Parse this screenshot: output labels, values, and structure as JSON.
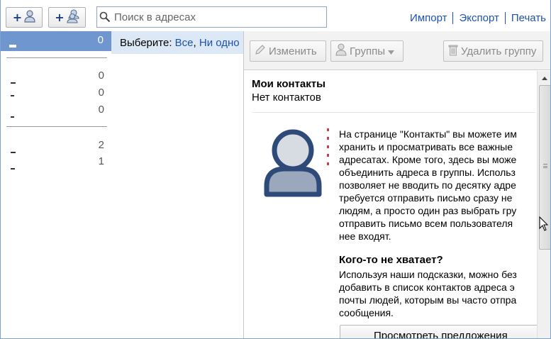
{
  "toolbar": {
    "add_contact_icon": "add-person-icon",
    "add_group_icon": "add-group-icon",
    "search_placeholder": "Поиск в адресах",
    "links": [
      "Импорт",
      "Экспорт",
      "Печать"
    ]
  },
  "sidebar": {
    "selected_count": "0",
    "items": [
      {
        "count": "0"
      },
      {
        "count": "0"
      },
      {
        "count": "0"
      },
      {
        "count": "2"
      },
      {
        "count": "1"
      }
    ]
  },
  "select_bar": {
    "label": "Выберите:",
    "all": "Все",
    "none": "Ни одно"
  },
  "panel_toolbar": {
    "edit": "Изменить",
    "groups": "Группы",
    "delete_group": "Удалить группу"
  },
  "content": {
    "title": "Мои контакты",
    "subtitle": "Нет контактов",
    "paragraph": "На странице \"Контакты\" вы можете им\nхранить и просматривать все важные\nадресатах. Кроме того, здесь вы може\nобъединить адреса в группы. Использ\nпозволяет не вводить по десятку адре\nтребуется отправить письмо сразу не\nлюдям, а просто один раз выбрать гру\nотправить письмо всем пользователя\nнее входят.",
    "heading2": "Кого-то не хватает?",
    "paragraph2": "Используя наши подсказки, можно без\nдобавить в список контактов адреса э\nпочты людей, которым вы часто отпра\nсообщения.",
    "suggest_button": "Просмотреть предложения"
  },
  "colors": {
    "link": "#1c52a8",
    "selected_bg": "#6f96cf",
    "select_bar_bg": "#dde8f6",
    "avatar": "#2e4a78"
  }
}
